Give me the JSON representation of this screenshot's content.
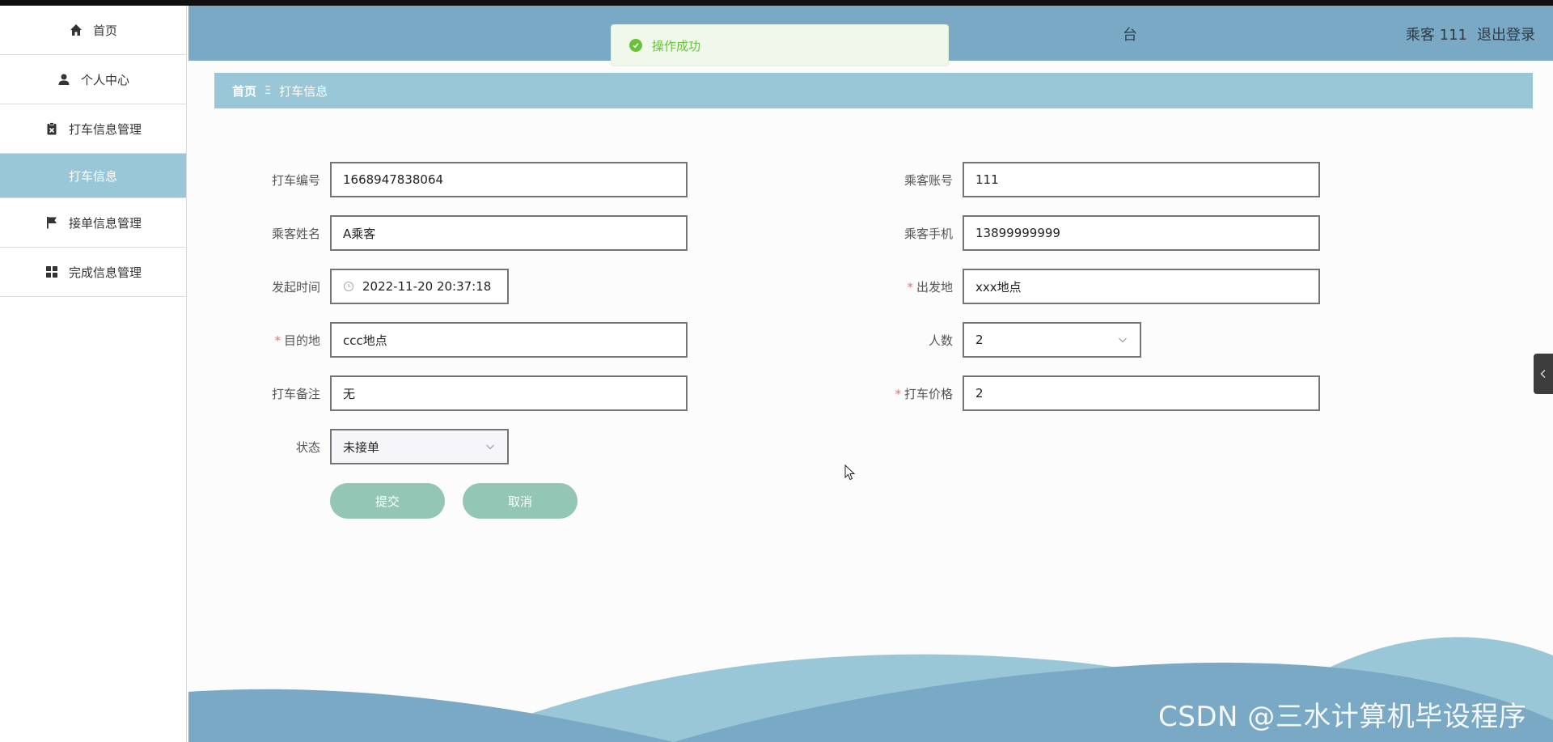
{
  "sidebar": {
    "items": [
      {
        "label": "首页",
        "icon": "home-icon"
      },
      {
        "label": "个人中心",
        "icon": "user-icon"
      },
      {
        "label": "打车信息管理",
        "icon": "clipboard-icon"
      },
      {
        "label": "打车信息",
        "icon": null,
        "active": true
      },
      {
        "label": "接单信息管理",
        "icon": "flag-icon"
      },
      {
        "label": "完成信息管理",
        "icon": "grid-icon"
      }
    ]
  },
  "header": {
    "title_partial": "台",
    "user": "乘客 111",
    "logout": "退出登录"
  },
  "toast": {
    "message": "操作成功"
  },
  "breadcrumb": {
    "home": "首页",
    "separator": "Ξ",
    "current": "打车信息"
  },
  "form": {
    "order_no": {
      "label": "打车编号",
      "value": "1668947838064"
    },
    "account": {
      "label": "乘客账号",
      "value": "111"
    },
    "name": {
      "label": "乘客姓名",
      "value": "A乘客"
    },
    "phone": {
      "label": "乘客手机",
      "value": "13899999999"
    },
    "start_time": {
      "label": "发起时间",
      "value": "2022-11-20 20:37:18"
    },
    "origin": {
      "label": "出发地",
      "value": "xxx地点",
      "required": true
    },
    "destination": {
      "label": "目的地",
      "value": "ccc地点",
      "required": true
    },
    "people": {
      "label": "人数",
      "value": "2"
    },
    "remark": {
      "label": "打车备注",
      "value": "无"
    },
    "price": {
      "label": "打车价格",
      "value": "2",
      "required": true
    },
    "status": {
      "label": "状态",
      "value": "未接单"
    }
  },
  "buttons": {
    "submit": "提交",
    "cancel": "取消"
  },
  "watermark": "CSDN @三水计算机毕设程序",
  "colors": {
    "header": "#79a9c4",
    "accent": "#9ac7d7",
    "button": "#93c6b4",
    "success": "#67c23a",
    "required": "#f56c6c"
  }
}
